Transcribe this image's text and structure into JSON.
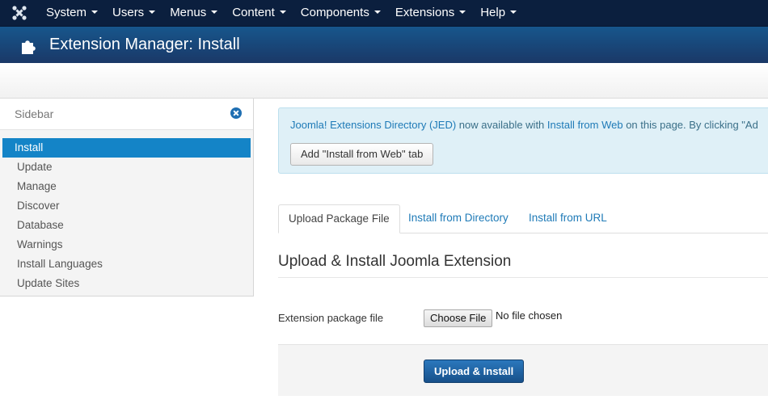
{
  "nav": {
    "logo_icon": "joomla-icon",
    "items": [
      "System",
      "Users",
      "Menus",
      "Content",
      "Components",
      "Extensions",
      "Help"
    ]
  },
  "header": {
    "title": "Extension Manager: Install",
    "icon": "puzzle-icon"
  },
  "sidebar": {
    "title": "Sidebar",
    "items": [
      "Install",
      "Update",
      "Manage",
      "Discover",
      "Database",
      "Warnings",
      "Install Languages",
      "Update Sites"
    ],
    "active": "Install"
  },
  "notice": {
    "link1": "Joomla! Extensions Directory (JED)",
    "text1": " now available with ",
    "link2": "Install from Web",
    "text2": " on this page.  By clicking \"Ad",
    "button": "Add \"Install from Web\" tab"
  },
  "tabs": [
    "Upload Package File",
    "Install from Directory",
    "Install from URL"
  ],
  "active_tab": "Upload Package File",
  "upload": {
    "heading": "Upload & Install Joomla Extension",
    "field_label": "Extension package file",
    "choose_button": "Choose File",
    "no_file": "No file chosen",
    "submit": "Upload & Install"
  }
}
